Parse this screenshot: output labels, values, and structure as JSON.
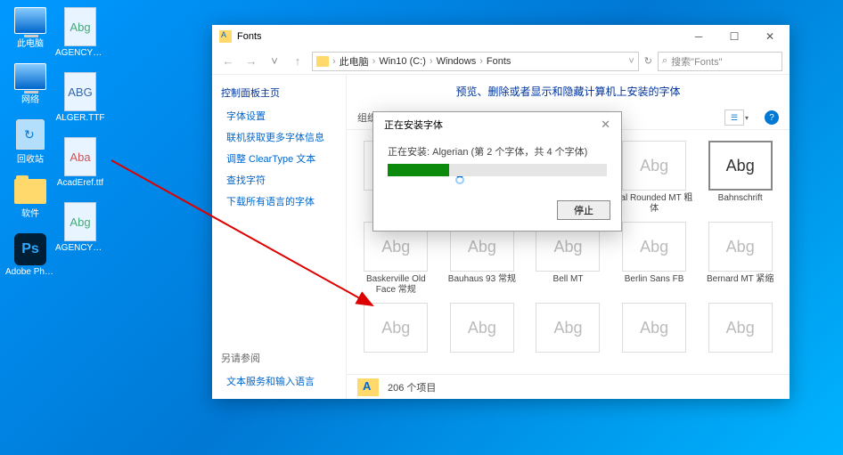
{
  "desktop": {
    "col1": [
      {
        "label": "此电脑",
        "kind": "pc"
      },
      {
        "label": "网络",
        "kind": "net"
      },
      {
        "label": "回收站",
        "kind": "bin"
      },
      {
        "label": "软件",
        "kind": "folder"
      },
      {
        "label": "Adobe Photosh...",
        "kind": "ps"
      }
    ],
    "col2": [
      {
        "label": "AGENCYR....",
        "kind": "font",
        "glyph": "Abg",
        "color": "#4a7"
      },
      {
        "label": "ALGER.TTF",
        "kind": "font",
        "glyph": "ABG",
        "color": "#36a"
      },
      {
        "label": "AcadEref.ttf",
        "kind": "font",
        "glyph": "Aba",
        "color": "#c55"
      },
      {
        "label": "AGENCYB....",
        "kind": "font",
        "glyph": "Abg",
        "color": "#4a7"
      }
    ]
  },
  "window": {
    "title": "Fonts",
    "nav": {
      "back": "←",
      "fwd": "→",
      "up": "↑"
    },
    "address": [
      "此电脑",
      "Win10 (C:)",
      "Windows",
      "Fonts"
    ],
    "refresh": "↻",
    "search_placeholder": "搜索\"Fonts\"",
    "sidebar": {
      "head": "控制面板主页",
      "items": [
        "字体设置",
        "联机获取更多字体信息",
        "调整 ClearType 文本",
        "查找字符",
        "下载所有语言的字体"
      ],
      "also_head": "另请参阅",
      "also_items": [
        "文本服务和输入语言"
      ]
    },
    "main_title": "预览、删除或者显示和隐藏计算机上安装的字体",
    "toolbar": {
      "organize": "组织 ▾"
    },
    "fonts_row1": [
      {
        "glyph": "",
        "name": ""
      },
      {
        "glyph": "",
        "name": ""
      },
      {
        "glyph": "",
        "name": ""
      },
      {
        "glyph": "Abg",
        "name": "rial Rounded MT 粗体"
      },
      {
        "glyph": "Abg",
        "name": "Bahnschrift",
        "highlight": true
      }
    ],
    "fonts_row2": [
      {
        "glyph": "Abg",
        "name": "Baskerville Old Face 常规"
      },
      {
        "glyph": "Abg",
        "name": "Bauhaus 93 常规"
      },
      {
        "glyph": "Abg",
        "name": "Bell MT"
      },
      {
        "glyph": "Abg",
        "name": "Berlin Sans FB"
      },
      {
        "glyph": "Abg",
        "name": "Bernard MT 紧缩"
      }
    ],
    "fonts_row3": [
      {
        "glyph": "Abg",
        "name": ""
      },
      {
        "glyph": "Abg",
        "name": ""
      },
      {
        "glyph": "Abg",
        "name": ""
      },
      {
        "glyph": "Abg",
        "name": ""
      },
      {
        "glyph": "Abg",
        "name": ""
      }
    ],
    "status": "206 个项目"
  },
  "dialog": {
    "title": "正在安装字体",
    "message": "正在安装: Algerian (第 2 个字体，共 4 个字体)",
    "button": "停止"
  }
}
